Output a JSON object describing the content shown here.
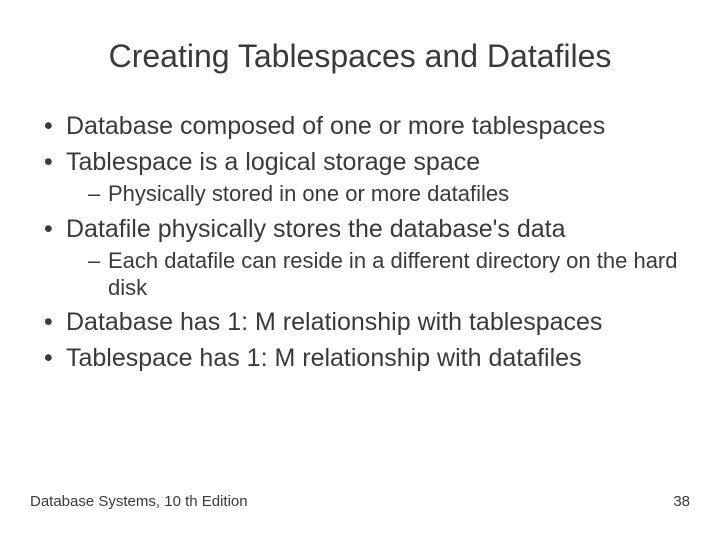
{
  "title": "Creating Tablespaces and Datafiles",
  "bullets": [
    {
      "text": "Database composed of one or more tablespaces",
      "sub": []
    },
    {
      "text": "Tablespace is a logical storage space",
      "sub": [
        "Physically stored in one or more datafiles"
      ]
    },
    {
      "text": "Datafile physically stores the database's data",
      "sub": [
        "Each datafile can reside in a different directory on the hard disk"
      ]
    },
    {
      "text": "Database has 1: M relationship with tablespaces",
      "sub": []
    },
    {
      "text": "Tablespace has 1: M relationship with datafiles",
      "sub": []
    }
  ],
  "footer": {
    "left": "Database Systems, 10 th Edition",
    "right": "38"
  }
}
